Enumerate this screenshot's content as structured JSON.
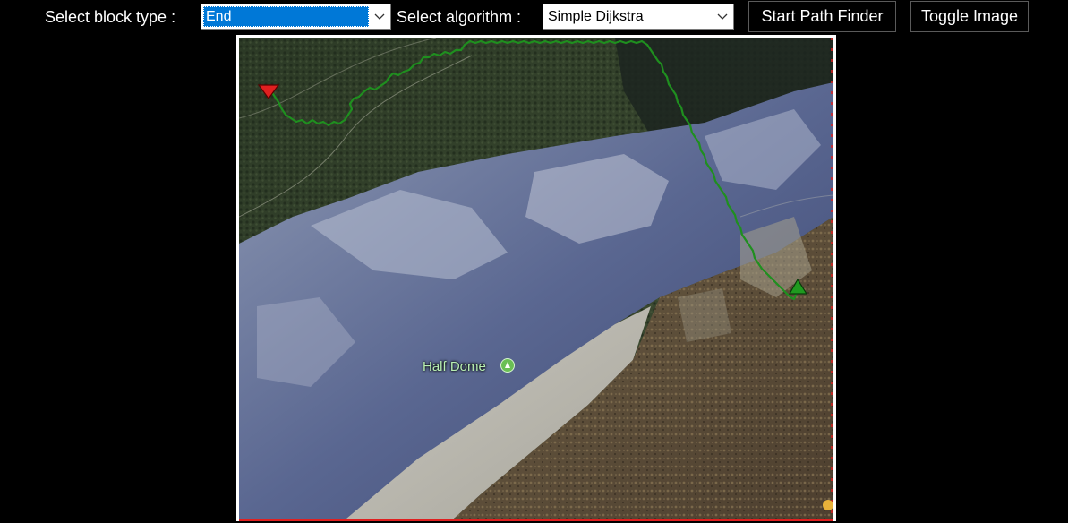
{
  "toolbar": {
    "block_type_label": "Select block type :",
    "block_type_value": "End",
    "algorithm_label": "Select algorithm :",
    "algorithm_value": "Simple Dijkstra",
    "start_button": "Start Path Finder",
    "toggle_button": "Toggle Image"
  },
  "map": {
    "place_label": "Half Dome",
    "path_color": "#1f8f1f",
    "start_marker_color": "#1f9a1f",
    "end_marker_color": "#e02020",
    "border_accent": "#e02020"
  },
  "icons": {
    "dropdown": "chevron-down-icon",
    "start": "triangle-up-icon",
    "end": "triangle-down-icon",
    "place": "pin-icon"
  }
}
